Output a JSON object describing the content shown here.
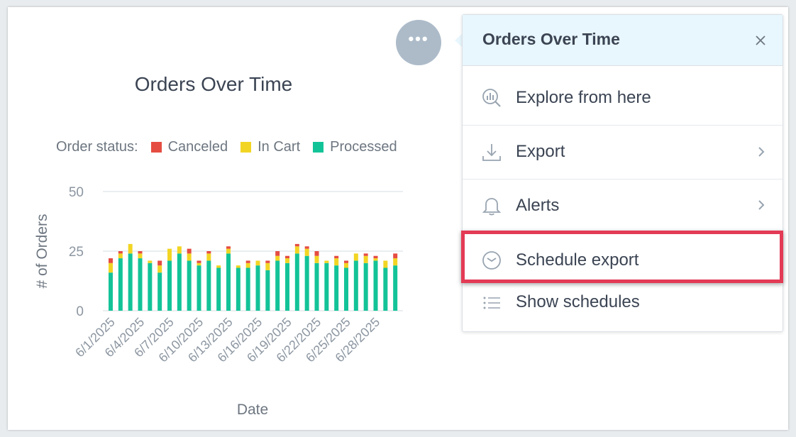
{
  "chart_data": {
    "type": "bar",
    "stacked": true,
    "title": "Orders Over Time",
    "legend_title": "Order status:",
    "xlabel": "Date",
    "ylabel": "# of Orders",
    "ylim": [
      0,
      50
    ],
    "yticks": [
      "0",
      "25",
      "50"
    ],
    "categories": [
      "6/1/2025",
      "6/2/2025",
      "6/3/2025",
      "6/4/2025",
      "6/5/2025",
      "6/6/2025",
      "6/7/2025",
      "6/8/2025",
      "6/9/2025",
      "6/10/2025",
      "6/11/2025",
      "6/12/2025",
      "6/13/2025",
      "6/14/2025",
      "6/15/2025",
      "6/16/2025",
      "6/17/2025",
      "6/18/2025",
      "6/19/2025",
      "6/20/2025",
      "6/21/2025",
      "6/22/2025",
      "6/23/2025",
      "6/24/2025",
      "6/25/2025",
      "6/26/2025",
      "6/27/2025",
      "6/28/2025",
      "6/29/2025",
      "6/30/2025"
    ],
    "tick_labels": [
      "6/1/2025",
      "6/4/2025",
      "6/7/2025",
      "6/10/2025",
      "6/13/2025",
      "6/16/2025",
      "6/19/2025",
      "6/22/2025",
      "6/25/2025",
      "6/28/2025"
    ],
    "tick_indices": [
      0,
      3,
      6,
      9,
      12,
      15,
      18,
      21,
      24,
      27
    ],
    "series": [
      {
        "name": "Processed",
        "color": "#13c398",
        "values": [
          16,
          22,
          24,
          22,
          20,
          16,
          21,
          24,
          21,
          19,
          21,
          18,
          24,
          18,
          18,
          19,
          17,
          21,
          20,
          24,
          23,
          20,
          20,
          19,
          18,
          21,
          20,
          21,
          18,
          19
        ]
      },
      {
        "name": "In Cart",
        "color": "#f2d524",
        "values": [
          4,
          2,
          4,
          2,
          1,
          3,
          5,
          3,
          3,
          1,
          3,
          1,
          2,
          1,
          2,
          2,
          3,
          2,
          2,
          3,
          3,
          3,
          1,
          3,
          2,
          3,
          3,
          1,
          3,
          3
        ]
      },
      {
        "name": "Canceled",
        "color": "#e54d42",
        "values": [
          2,
          1,
          0,
          1,
          0,
          2,
          0,
          0,
          2,
          1,
          1,
          0,
          1,
          0,
          1,
          0,
          1,
          2,
          1,
          1,
          1,
          2,
          0,
          1,
          1,
          0,
          1,
          1,
          0,
          2
        ]
      }
    ],
    "legend_order": [
      "Canceled",
      "In Cart",
      "Processed"
    ],
    "legend_placement": "top",
    "grid": true
  },
  "actions_button": {
    "glyph": "•••"
  },
  "menu": {
    "title": "Orders Over Time",
    "close_glyph": "×",
    "items": [
      {
        "label": "Explore from here",
        "icon": "explore-analytics-icon",
        "submenu": false
      },
      {
        "label": "Export",
        "icon": "download-icon",
        "submenu": true
      },
      {
        "label": "Alerts",
        "icon": "bell-icon",
        "submenu": true
      },
      {
        "label": "Schedule export",
        "icon": "clock-icon",
        "submenu": false,
        "highlighted": true
      },
      {
        "label": "Show schedules",
        "icon": "list-icon",
        "submenu": false
      }
    ]
  },
  "colors": {
    "highlight": "#e33a55",
    "menu_header_bg": "#e8f6fd",
    "actions_button_bg": "#adbbc9"
  }
}
